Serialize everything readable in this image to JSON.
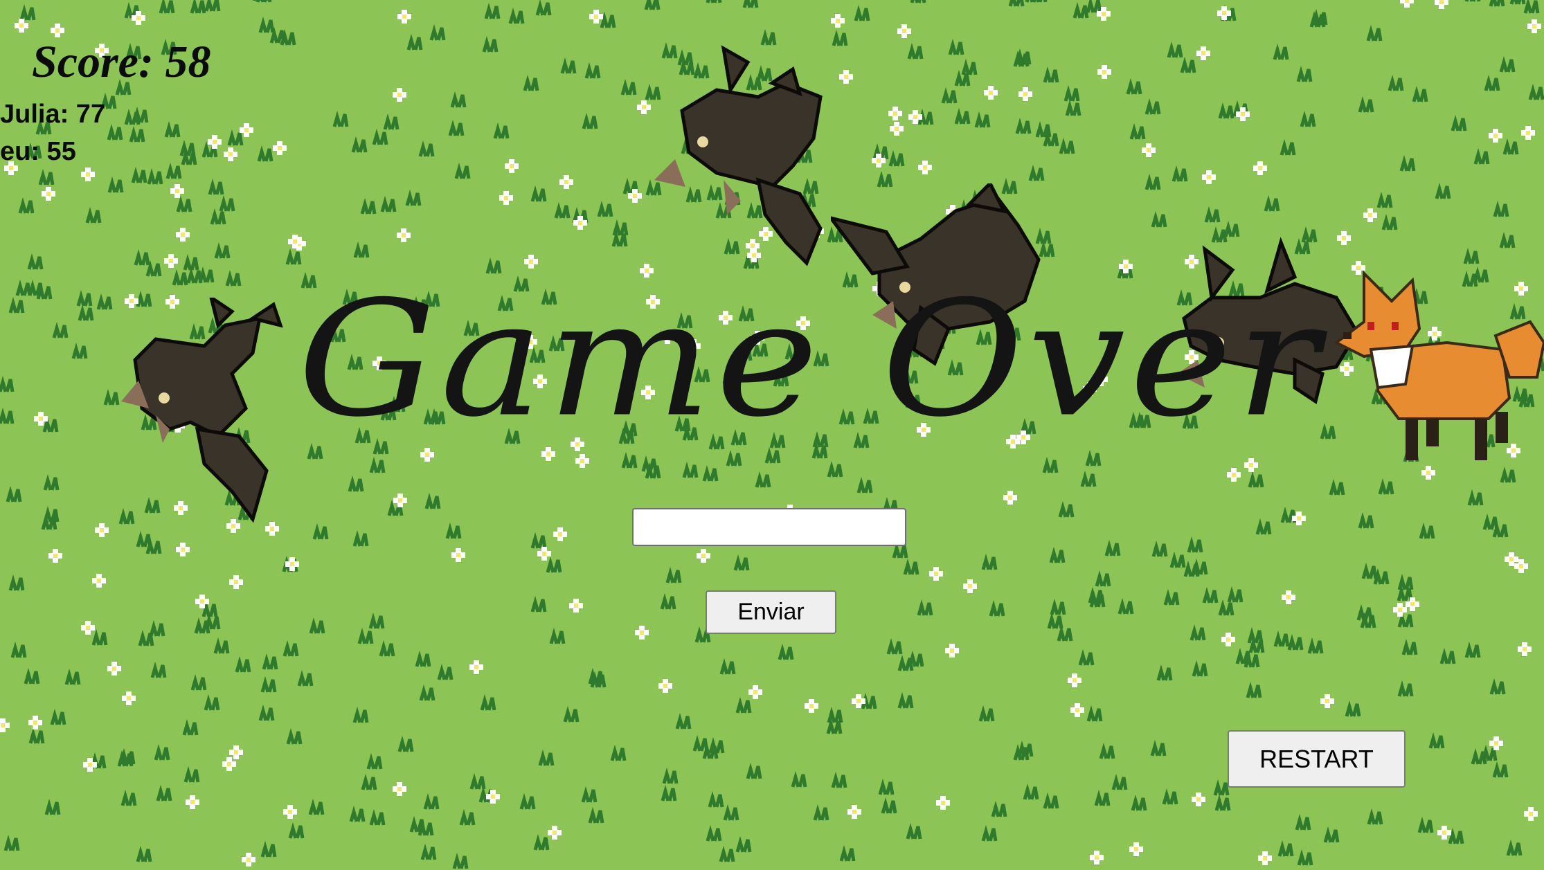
{
  "hud": {
    "score_text": "Score: 58",
    "leaderboard": [
      {
        "text": "Julia: 77"
      },
      {
        "text": "eu: 55"
      }
    ]
  },
  "title": "Game Over",
  "form": {
    "name_value": "",
    "name_placeholder": "",
    "submit_label": "Enviar"
  },
  "restart_label": "RESTART",
  "colors": {
    "grass": "#8cc556",
    "grass_dark": "#2f7a2c",
    "flower": "#ffffff",
    "flower_center": "#f5e56b",
    "creature": "#3a332a",
    "fox": "#e88c32"
  },
  "sprites": [
    "dark-cat-creature",
    "dark-cat-creature",
    "dark-cat-creature",
    "dark-cat-creature",
    "fox"
  ]
}
